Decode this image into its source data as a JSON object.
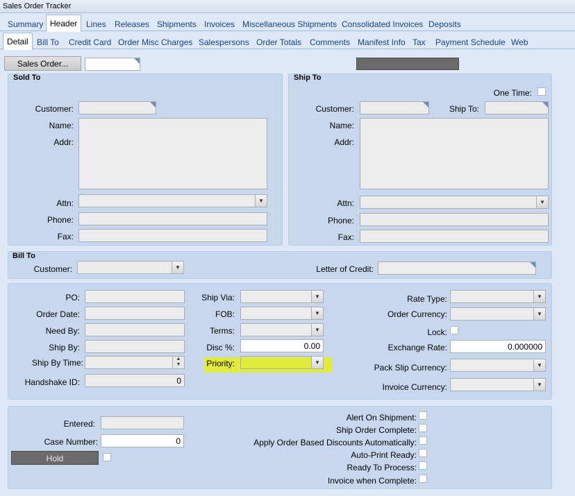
{
  "window": {
    "title": "Sales Order Tracker"
  },
  "tabs_main": [
    "Summary",
    "Header",
    "Lines",
    "Releases",
    "Shipments",
    "Invoices",
    "Miscellaneous Shipments",
    "Consolidated Invoices",
    "Deposits"
  ],
  "tabs_sub": [
    "Detail",
    "Bill To",
    "Credit Card",
    "Order Misc Charges",
    "Salespersons",
    "Order Totals",
    "Comments",
    "Manifest Info",
    "Tax",
    "Payment Schedule",
    "Web"
  ],
  "toolbar": {
    "sales_order_button": "Sales Order...",
    "sales_order_value": ""
  },
  "sold_to": {
    "title": "Sold To",
    "customer_label": "Customer:",
    "name_label": "Name:",
    "addr_label": "Addr:",
    "attn_label": "Attn:",
    "phone_label": "Phone:",
    "fax_label": "Fax:"
  },
  "ship_to": {
    "title": "Ship To",
    "one_time_label": "One Time:",
    "customer_label": "Customer:",
    "ship_to_label": "Ship To:",
    "name_label": "Name:",
    "addr_label": "Addr:",
    "attn_label": "Attn:",
    "phone_label": "Phone:",
    "fax_label": "Fax:"
  },
  "bill_to": {
    "title": "Bill To",
    "customer_label": "Customer:",
    "letter_of_credit_label": "Letter of Credit:"
  },
  "order": {
    "po_label": "PO:",
    "order_date_label": "Order Date:",
    "need_by_label": "Need By:",
    "ship_by_label": "Ship By:",
    "ship_by_time_label": "Ship By Time:",
    "handshake_label": "Handshake ID:",
    "handshake_value": "0",
    "ship_via_label": "Ship Via:",
    "fob_label": "FOB:",
    "terms_label": "Terms:",
    "disc_label": "Disc %:",
    "disc_value": "0.00",
    "priority_label": "Priority:",
    "rate_type_label": "Rate Type:",
    "order_currency_label": "Order Currency:",
    "lock_label": "Lock:",
    "exchange_rate_label": "Exchange Rate:",
    "exchange_rate_value": "0.000000",
    "pack_slip_currency_label": "Pack Slip Currency:",
    "invoice_currency_label": "Invoice Currency:"
  },
  "footer": {
    "entered_label": "Entered:",
    "case_number_label": "Case Number:",
    "case_number_value": "0",
    "hold_button": "Hold",
    "alert_on_shipment": "Alert On Shipment:",
    "ship_order_complete": "Ship Order Complete:",
    "apply_discounts": "Apply Order Based Discounts Automatically:",
    "auto_print_ready": "Auto-Print Ready:",
    "ready_to_process": "Ready To Process:",
    "invoice_when_complete": "Invoice when Complete:"
  },
  "colors": {
    "background": "#dfe8f6",
    "panel": "#c7d8ee",
    "tab_text": "#15428b",
    "highlight": "#e6ef1a",
    "dark_button": "#6b6b6b"
  }
}
